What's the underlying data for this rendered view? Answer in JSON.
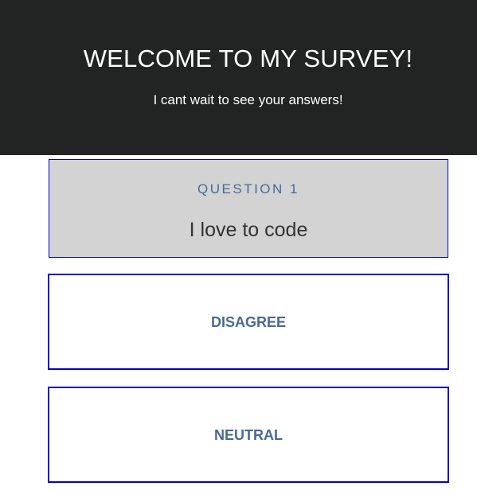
{
  "header": {
    "title": "WELCOME TO MY SURVEY!",
    "subtitle": "I cant wait to see your answers!"
  },
  "question": {
    "number_label": "QUESTION 1",
    "text": "I love to code"
  },
  "answers": [
    {
      "label": "DISAGREE"
    },
    {
      "label": "NEUTRAL"
    }
  ],
  "colors": {
    "header_background": "#222323",
    "card_background": "#d3d3d3",
    "border": "#0000cd",
    "accent_text": "#4a6a94"
  }
}
